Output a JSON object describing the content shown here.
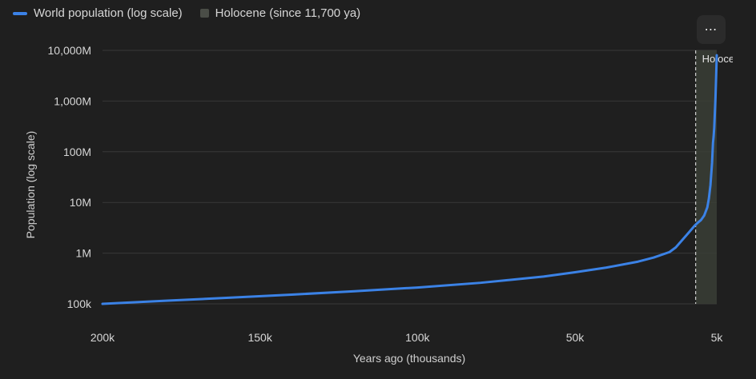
{
  "legend": {
    "series_label": "World population (log scale)",
    "band_label": "Holocene (since 11,700 ya)"
  },
  "more_button": {
    "label": "⋯",
    "icon": "more-horizontal-icon"
  },
  "chart_data": {
    "type": "line",
    "xlabel": "Years ago (thousands)",
    "ylabel": "Population (log scale)",
    "x_ticks": [
      {
        "value": 200000,
        "label": "200k"
      },
      {
        "value": 150000,
        "label": "150k"
      },
      {
        "value": 100000,
        "label": "100k"
      },
      {
        "value": 50000,
        "label": "50k"
      },
      {
        "value": 5000,
        "label": "5k"
      }
    ],
    "y_ticks": [
      {
        "value": 100000,
        "label": "100k"
      },
      {
        "value": 1000000,
        "label": "1M"
      },
      {
        "value": 10000000,
        "label": "10M"
      },
      {
        "value": 100000000,
        "label": "100M"
      },
      {
        "value": 1000000000,
        "label": "1,000M"
      },
      {
        "value": 10000000000,
        "label": "10,000M"
      }
    ],
    "x_range": [
      200000,
      5000
    ],
    "y_scale": "log",
    "y_range": [
      100000,
      10000000000
    ],
    "grid": "horizontal",
    "legend_position": "top-left",
    "band": {
      "name": "Holocene (since 11,700 ya)",
      "from": 11700,
      "to": 5000,
      "label": "Holocene be",
      "color": "#3a3e36"
    },
    "series": [
      {
        "name": "World population (log scale)",
        "color": "#3b82e6",
        "x": [
          200000,
          180000,
          160000,
          140000,
          120000,
          100000,
          80000,
          60000,
          50000,
          40000,
          30000,
          25000,
          20000,
          18000,
          16000,
          14000,
          12000,
          11000,
          10000,
          9000,
          8000,
          7500,
          7000,
          6500,
          6200,
          6000,
          5800,
          5600,
          5400,
          5200,
          5000
        ],
        "y": [
          100000,
          115000,
          132000,
          152000,
          177000,
          210000,
          260000,
          345000,
          420000,
          520000,
          680000,
          820000,
          1050000,
          1300000,
          1800000,
          2500000,
          3500000,
          4000000,
          4500000,
          5500000,
          8000000,
          12000000,
          22000000,
          60000000,
          150000000,
          200000000,
          300000000,
          600000000,
          1200000000,
          3000000000,
          8000000000
        ]
      }
    ]
  }
}
